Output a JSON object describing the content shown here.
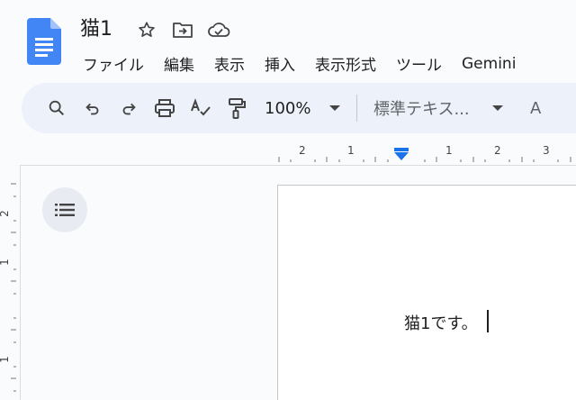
{
  "document": {
    "title": "猫1",
    "body_text": "猫1です。"
  },
  "title_icons": [
    "star-icon",
    "move-to-folder-icon",
    "cloud-saved-icon"
  ],
  "menu": {
    "items": [
      "ファイル",
      "編集",
      "表示",
      "挿入",
      "表示形式",
      "ツール",
      "Gemini"
    ]
  },
  "toolbar": {
    "zoom": "100%",
    "style": "標準テキス...",
    "truncated": "A"
  },
  "ruler": {
    "horizontal_labels": [
      "2",
      "1",
      "1",
      "2",
      "3"
    ],
    "vertical_labels": [
      "2",
      "1",
      "1"
    ]
  },
  "colors": {
    "brand_blue": "#4285f4",
    "toolbar_bg": "#edf2fa",
    "page_bg": "#f9fbfd"
  }
}
